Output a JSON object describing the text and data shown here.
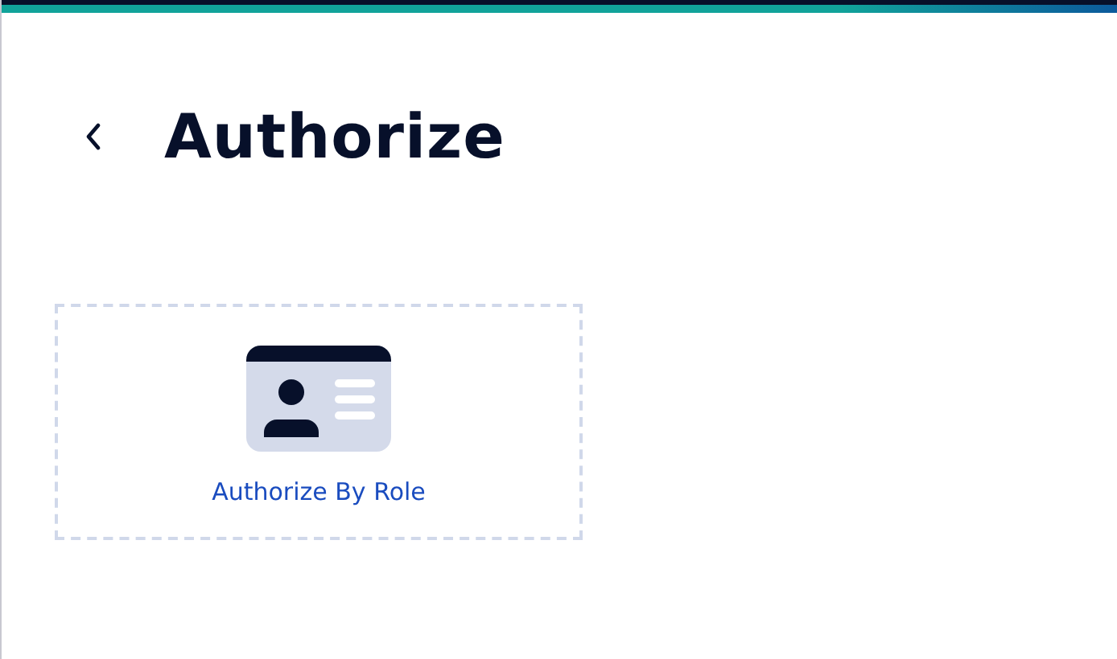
{
  "header": {
    "title": "Authorize"
  },
  "options": [
    {
      "label": "Authorize By Role"
    }
  ]
}
